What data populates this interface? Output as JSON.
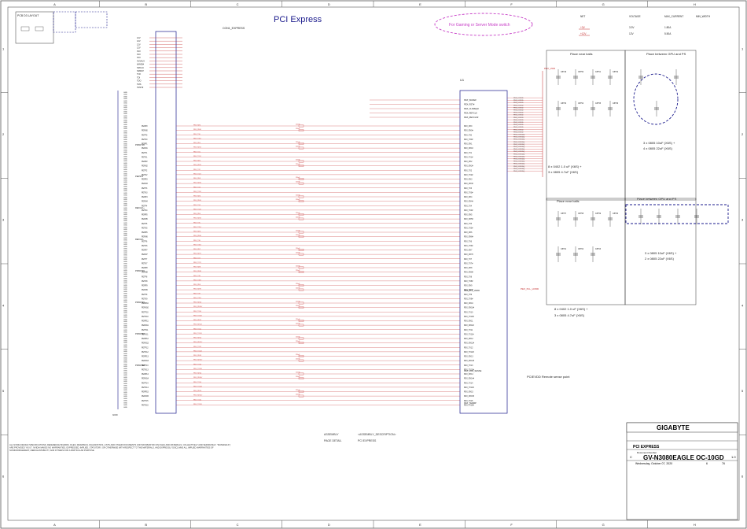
{
  "title": "PCI Express",
  "border": {
    "cols": [
      "A",
      "B",
      "C",
      "D",
      "E",
      "F",
      "G",
      "H"
    ],
    "rows": [
      "1",
      "2",
      "3",
      "4",
      "5",
      "6"
    ]
  },
  "annotations": {
    "gaming_mode": "For Gaming or Server Mode switch",
    "pcb_layout": "PCB D3 LAYOUT",
    "pcievdd_remote_sense": "PCIEVDD Remote sense point",
    "cap_note_1": "3 x 0805 10uF (X6S) +",
    "cap_note_2": "4 x 0805 22uF (X6S)",
    "cap_note_3": "8 x 0402 1.0 uF (X6S) +",
    "cap_note_4": "3 x 0805 4.7uF (X6S)",
    "cap_note_5": "3 x 0805 10uF (X6S) +",
    "cap_note_6": "2 x 0805 22uF (X6S)",
    "cap_note_7": "8 x 0402 1.0 uF (X6S) +",
    "cap_note_8": "3 x 0805 4.7uF (X6S)",
    "place_near_balls_1": "Place near balls",
    "place_between_1": "Place between GPU and PS",
    "place_near_balls_2": "Place near balls",
    "place_between_2": "Place between GPU and PS",
    "disclaimer": "ALL NVIDIA DESIGN SPECIFICATIONS, REFERENCE BOARDS, FILES, DRAWINGS, DIAGNOSTICS, LISTS AND OTHER DOCUMENTS (OR INFORMATION ON FILES AND MATERIALS, COLLECTIVELY AND SEPARATELY, \"MATERIALS\") ARE PROVIDED \"AS IS\". NVIDIA MAKES NO WARRANTIES, EXPRESSED, IMPLIED, STATUTORY, OR OTHERWISE WITH RESPECT TO THE MATERIALS, AND EXPRESSLY DISCLAIMS ALL IMPLIED WARRANTIES OF NONINFRINGEMENT, MERCHANTABILITY, AND FITNESS FOR A PARTICULAR PURPOSE."
  },
  "title_block": {
    "company": "GIGABYTE",
    "sheet_title": "PCI EXPRESS",
    "doc_label": "Document Number",
    "doc_number": "GV-N3080EAGLE OC-10GD",
    "rev": "1.0",
    "date": "Wednesday, October 07, 2020",
    "sheet": "6",
    "of": "76",
    "size": "C",
    "assembly": "ASSEMBLY",
    "page_detail": "PAGE DETAIL",
    "assembly_desc": "<ASSEMBLY_DESCRIPTION>",
    "pci_express": "PCI EXPRESS"
  },
  "net_table": {
    "headers": [
      "NET",
      "VOLTAGE",
      "MAX_CURRENT",
      "MIN_WIDTH"
    ],
    "rows": [
      [
        "+3V",
        "3.3V",
        "1.80A"
      ],
      [
        "+12V",
        "12V",
        "5.50A"
      ]
    ]
  },
  "connector": {
    "refdes": "CON1_EXPRESS",
    "pins_top": [
      "12V",
      "12V",
      "12V",
      "12V",
      "3V3",
      "3V3",
      "3V3",
      "3V3AUX",
      "WAKE#",
      "SMCLK",
      "SMDAT",
      "TCK",
      "TDI",
      "TDO",
      "TMS",
      "TRST#"
    ],
    "pins_side": [
      "PRSNT1#",
      "PERST#",
      "REFCLK+",
      "REFCLK-",
      "PRSNT2#",
      "PRSNT2#",
      "PRSNT2#",
      "PRSNT2#"
    ],
    "lanes": [
      "PERP0",
      "PERN0",
      "PETP0",
      "PETN0",
      "PERP1",
      "PERN1",
      "PETP1",
      "PETN1",
      "PERP2",
      "PERN2",
      "PETP2",
      "PETN2",
      "PERP3",
      "PERN3",
      "PETP3",
      "PETN3",
      "PERP4",
      "PERN4",
      "PETP4",
      "PETN4",
      "PERP5",
      "PERN5",
      "PETP5",
      "PETN5",
      "PERP6",
      "PERN6",
      "PETP6",
      "PETN6",
      "PERP7",
      "PERN7",
      "PETP7",
      "PETN7",
      "PERP8",
      "PERN8",
      "PETP8",
      "PETN8",
      "PERP9",
      "PERN9",
      "PETP9",
      "PETN9",
      "PERP10",
      "PERN10",
      "PETP10",
      "PETN10",
      "PERP11",
      "PERN11",
      "PETP11",
      "PETN11",
      "PERP12",
      "PERN12",
      "PETP12",
      "PETN12",
      "PERP13",
      "PERN13",
      "PETP13",
      "PETN13",
      "PERP14",
      "PERN14",
      "PETP14",
      "PETN14",
      "PERP15",
      "PERN15",
      "PETP15",
      "PETN15"
    ],
    "gnd_label": "GND"
  },
  "gpu": {
    "refdes": "U1",
    "pins_top": [
      "PEX_WAKE#",
      "PEX_RST#",
      "PEX_CLKREQ#",
      "PEX_REFCLK",
      "PEX_REFCLK#"
    ],
    "lanes": [
      "PEX_RX0",
      "PEX_RX0#",
      "PEX_TX0",
      "PEX_TX0#",
      "PEX_RX1",
      "PEX_RX1#",
      "PEX_TX1",
      "PEX_TX1#",
      "PEX_RX2",
      "PEX_RX2#",
      "PEX_TX2",
      "PEX_TX2#",
      "PEX_RX3",
      "PEX_RX3#",
      "PEX_TX3",
      "PEX_TX3#",
      "PEX_RX4",
      "PEX_RX4#",
      "PEX_TX4",
      "PEX_TX4#",
      "PEX_RX5",
      "PEX_RX5#",
      "PEX_TX5",
      "PEX_TX5#",
      "PEX_RX6",
      "PEX_RX6#",
      "PEX_TX6",
      "PEX_TX6#",
      "PEX_RX7",
      "PEX_RX7#",
      "PEX_TX7",
      "PEX_TX7#",
      "PEX_RX8",
      "PEX_RX8#",
      "PEX_TX8",
      "PEX_TX8#",
      "PEX_RX9",
      "PEX_RX9#",
      "PEX_TX9",
      "PEX_TX9#",
      "PEX_RX10",
      "PEX_RX10#",
      "PEX_TX10",
      "PEX_TX10#",
      "PEX_RX11",
      "PEX_RX11#",
      "PEX_TX11",
      "PEX_TX11#",
      "PEX_RX12",
      "PEX_RX12#",
      "PEX_TX12",
      "PEX_TX12#",
      "PEX_RX13",
      "PEX_RX13#",
      "PEX_TX13",
      "PEX_TX13#",
      "PEX_RX14",
      "PEX_RX14#",
      "PEX_TX14",
      "PEX_TX14#",
      "PEX_RX15",
      "PEX_RX15#",
      "PEX_TX15",
      "PEX_TX15#"
    ],
    "pwr_pins": [
      "PEX_IOVDD",
      "PEX_IOVDD",
      "PEX_IOVDD",
      "PEX_IOVDD",
      "PEX_IOVDD",
      "PEX_IOVDD",
      "PEX_IOVDD",
      "PEX_IOVDD",
      "PEX_IOVDD",
      "PEX_IOVDD",
      "PEX_IOVDD",
      "PEX_IOVDD",
      "PEX_IOVDD",
      "PEX_IOVDD",
      "PEX_IOVDD",
      "PEX_IOVDDQ",
      "PEX_IOVDDQ",
      "PEX_IOVDDQ",
      "PEX_IOVDDQ",
      "PEX_IOVDDQ",
      "PEX_IOVDDQ",
      "PEX_IOVDDQ",
      "PEX_IOVDDQ",
      "PEX_IOVDDQ",
      "PEX_IOVDDQ",
      "PEX_IOVDDQ",
      "PEX_IOVDDQ",
      "PEX_IOVDDQ",
      "PEX_IOVDDQ",
      "PEX_IOVDDQ",
      "PEX_IOVDDQ"
    ],
    "pll_pin": "PEX_PLL_HVDD",
    "sense_pin": "PEX_VDD_SENSE",
    "term_pin": "PEX_TERMP"
  },
  "caps_top": [
    "C8749",
    "C8750",
    "C8751",
    "C8752",
    "C8753",
    "C8754",
    "C8755",
    "C8756"
  ],
  "caps_bot": [
    "C8757",
    "C8758",
    "C8759",
    "C8760",
    "C8761",
    "C8762",
    "C8763"
  ],
  "labels": {
    "pex_vdd": "PEX_VDD",
    "pex_pll": "PEX_PLL_HVDD",
    "gnd": "GND",
    "v3": "+3V",
    "v12": "+12V",
    "ac_cap": "220nF",
    "strap": "PEX_TX0_N"
  }
}
